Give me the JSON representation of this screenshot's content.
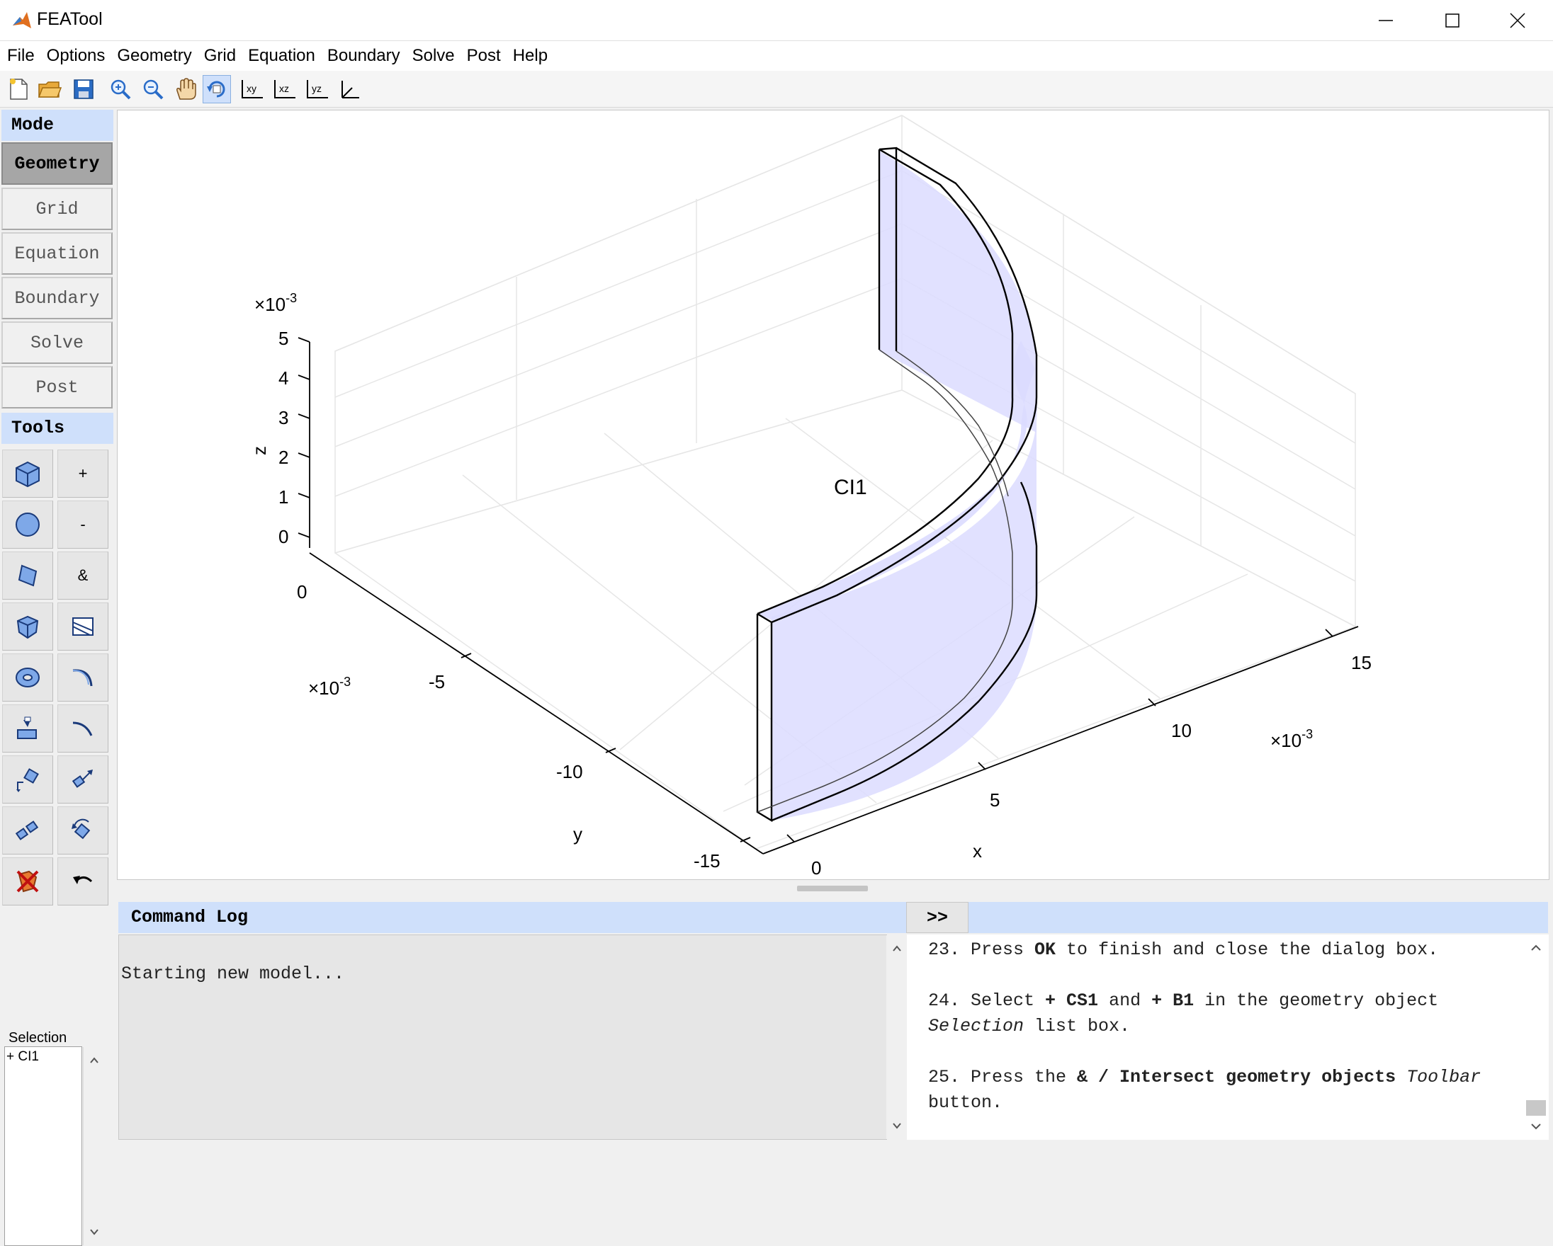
{
  "window": {
    "title": "FEATool"
  },
  "menubar": [
    "File",
    "Options",
    "Geometry",
    "Grid",
    "Equation",
    "Boundary",
    "Solve",
    "Post",
    "Help"
  ],
  "toolbar": {
    "icons": [
      "new-file-icon",
      "open-folder-icon",
      "save-icon",
      "zoom-in-icon",
      "zoom-out-icon",
      "pan-hand-icon",
      "rotate-3d-icon",
      "view-xy-icon",
      "view-xz-icon",
      "view-yz-icon",
      "view-3d-axes-icon"
    ]
  },
  "mode": {
    "header": "Mode",
    "buttons": [
      "Geometry",
      "Grid",
      "Equation",
      "Boundary",
      "Solve",
      "Post"
    ],
    "active": "Geometry"
  },
  "tools": {
    "header": "Tools",
    "left_icons": [
      "cube-icon",
      "circle-icon",
      "cylinder-icon",
      "polyhedron-icon",
      "torus-icon",
      "extrude-icon",
      "transform-icon",
      "link-icon",
      "delete-icon"
    ],
    "right_labels": [
      "+",
      "-",
      "&"
    ],
    "right_icons": [
      "split-icon",
      "fillet-icon",
      "chamfer-icon",
      "move-icon",
      "rotate-icon",
      "undo-icon"
    ]
  },
  "selection": {
    "label": "Selection",
    "items": [
      "+ CI1"
    ]
  },
  "plot": {
    "object_label": "CI1",
    "z_axis": {
      "label": "z",
      "ticks": [
        "0",
        "1",
        "2",
        "3",
        "4",
        "5"
      ],
      "multiplier_base": "×10",
      "multiplier_exp": "-3"
    },
    "y_axis": {
      "label": "y",
      "ticks": [
        "0",
        "-5",
        "-10",
        "-15"
      ],
      "multiplier_base": "×10",
      "multiplier_exp": "-3"
    },
    "x_axis": {
      "label": "x",
      "ticks": [
        "0",
        "5",
        "10",
        "15"
      ],
      "multiplier_base": "×10",
      "multiplier_exp": "-3"
    }
  },
  "command_log": {
    "header": "Command Log",
    "expand_label": ">>",
    "text": "Starting new model..."
  },
  "help": {
    "steps": [
      {
        "num": "23.",
        "parts": [
          [
            "n",
            "Press "
          ],
          [
            "b",
            "OK"
          ],
          [
            "n",
            " to finish and close the dialog box."
          ]
        ]
      },
      {
        "num": "24.",
        "parts": [
          [
            "n",
            "Select "
          ],
          [
            "b",
            "+ CS1"
          ],
          [
            "n",
            " and "
          ],
          [
            "b",
            "+ B1"
          ],
          [
            "n",
            " in the geometry object "
          ],
          [
            "i",
            "Selection"
          ],
          [
            "n",
            " list box."
          ]
        ]
      },
      {
        "num": "25.",
        "parts": [
          [
            "n",
            "Press the "
          ],
          [
            "b",
            "& / Intersect geometry objects"
          ],
          [
            "n",
            " "
          ],
          [
            "i",
            "Toolbar"
          ],
          [
            "n",
            " button."
          ]
        ]
      }
    ]
  },
  "colors": {
    "panel_header": "#cfe0fb",
    "shape_fill": "#dcdcff",
    "active_mode": "#a6a6a6"
  }
}
